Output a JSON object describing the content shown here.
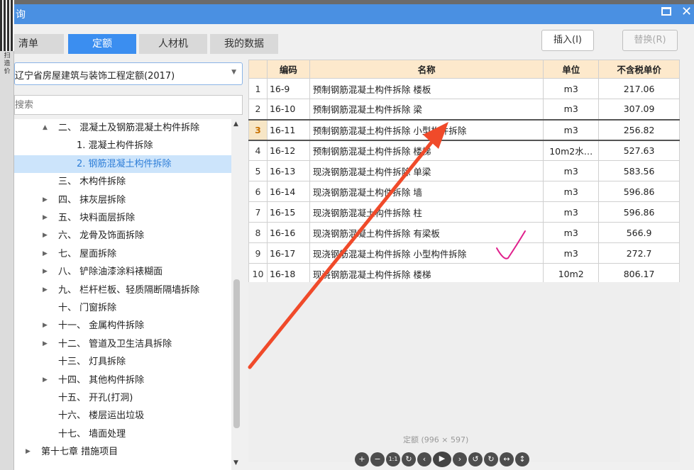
{
  "background": {
    "left_column_text": "扫 造价"
  },
  "window": {
    "title": "询",
    "maximize_icon": "maximize-icon",
    "close_label": "✕"
  },
  "tabs": [
    {
      "label": "清单",
      "active": false
    },
    {
      "label": "定额",
      "active": true
    },
    {
      "label": "人材机",
      "active": false
    },
    {
      "label": "我的数据",
      "active": false
    }
  ],
  "toolbar": {
    "insert_label": "插入(I)",
    "replace_label": "替换(R)"
  },
  "library": {
    "selected": "辽宁省房屋建筑与装饰工程定额(2017)"
  },
  "search": {
    "placeholder": "搜索"
  },
  "tree": [
    {
      "label": "二、 混凝土及钢筋混凝土构件拆除",
      "expander": "▲",
      "level": 1
    },
    {
      "label": "1. 混凝土构件拆除",
      "expander": "",
      "level": 2
    },
    {
      "label": "2. 钢筋混凝土构件拆除",
      "expander": "",
      "level": 2,
      "selected": true
    },
    {
      "label": "三、 木构件拆除",
      "expander": "",
      "level": 1
    },
    {
      "label": "四、 抹灰层拆除",
      "expander": "▶",
      "level": 1
    },
    {
      "label": "五、 块料面层拆除",
      "expander": "▶",
      "level": 1
    },
    {
      "label": "六、 龙骨及饰面拆除",
      "expander": "▶",
      "level": 1
    },
    {
      "label": "七、 屋面拆除",
      "expander": "▶",
      "level": 1
    },
    {
      "label": "八、 铲除油漆涂料裱糊面",
      "expander": "▶",
      "level": 1
    },
    {
      "label": "九、 栏杆栏板、轻质隔断隔墙拆除",
      "expander": "▶",
      "level": 1
    },
    {
      "label": "十、 门窗拆除",
      "expander": "",
      "level": 1
    },
    {
      "label": "十一、 金属构件拆除",
      "expander": "▶",
      "level": 1
    },
    {
      "label": "十二、 管道及卫生洁具拆除",
      "expander": "▶",
      "level": 1
    },
    {
      "label": "十三、 灯具拆除",
      "expander": "",
      "level": 1
    },
    {
      "label": "十四、 其他构件拆除",
      "expander": "▶",
      "level": 1
    },
    {
      "label": "十五、 开孔(打洞)",
      "expander": "",
      "level": 1
    },
    {
      "label": "十六、 楼层运出垃圾",
      "expander": "",
      "level": 1
    },
    {
      "label": "十七、 墙面处理",
      "expander": "",
      "level": 1
    },
    {
      "label": "第十七章 措施项目",
      "expander": "▶",
      "level": 0
    }
  ],
  "table": {
    "columns": [
      "编码",
      "名称",
      "单位",
      "不含税单价"
    ],
    "rows": [
      {
        "n": "1",
        "code": "16-9",
        "name": "预制钢筋混凝土构件拆除 楼板",
        "unit": "m3",
        "price": "217.06"
      },
      {
        "n": "2",
        "code": "16-10",
        "name": "预制钢筋混凝土构件拆除 梁",
        "unit": "m3",
        "price": "307.09"
      },
      {
        "n": "3",
        "code": "16-11",
        "name": "预制钢筋混凝土构件拆除 小型构件拆除",
        "unit": "m3",
        "price": "256.82",
        "selected": true
      },
      {
        "n": "4",
        "code": "16-12",
        "name": "预制钢筋混凝土构件拆除 楼梯",
        "unit": "10m2水…",
        "price": "527.63"
      },
      {
        "n": "5",
        "code": "16-13",
        "name": "现浇钢筋混凝土构件拆除 单梁",
        "unit": "m3",
        "price": "583.56"
      },
      {
        "n": "6",
        "code": "16-14",
        "name": "现浇钢筋混凝土构件拆除 墙",
        "unit": "m3",
        "price": "596.86"
      },
      {
        "n": "7",
        "code": "16-15",
        "name": "现浇钢筋混凝土构件拆除 柱",
        "unit": "m3",
        "price": "596.86"
      },
      {
        "n": "8",
        "code": "16-16",
        "name": "现浇钢筋混凝土构件拆除 有梁板",
        "unit": "m3",
        "price": "566.9"
      },
      {
        "n": "9",
        "code": "16-17",
        "name": "现浇钢筋混凝土构件拆除 小型构件拆除",
        "unit": "m3",
        "price": "272.7"
      },
      {
        "n": "10",
        "code": "16-18",
        "name": "现浇钢筋混凝土构件拆除 楼梯",
        "unit": "10m2",
        "price": "806.17"
      }
    ]
  },
  "viewer": {
    "caption": "定额 (996 × 597)",
    "buttons": [
      "zoom-in-icon",
      "zoom-out-icon",
      "actual-size-icon",
      "refresh-icon",
      "prev-icon",
      "play-icon",
      "next-icon",
      "rotate-left-icon",
      "rotate-right-icon",
      "flip-horizontal-icon",
      "flip-vertical-icon"
    ]
  },
  "colors": {
    "titlebar": "#4a90e2",
    "active_tab": "#3b8ef0",
    "header_bg": "#fde9cc",
    "tree_selected": "#cce4fb",
    "arrow_annotation": "#f04a2a",
    "check_annotation": "#e0208c"
  }
}
